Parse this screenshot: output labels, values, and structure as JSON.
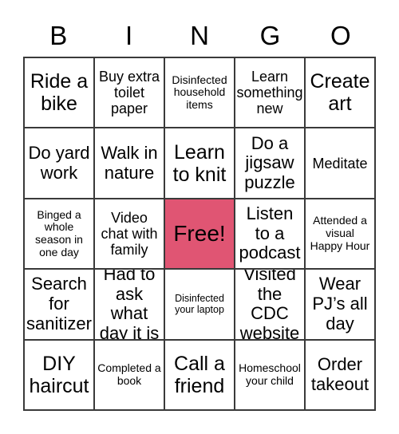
{
  "card": {
    "header_letters": [
      "B",
      "I",
      "N",
      "G",
      "O"
    ],
    "free_space_color": "#E05573",
    "border_color": "#3a3a3a",
    "background_color": "#ffffff",
    "text_color": "#000000",
    "grid_size": "5x5",
    "rows": [
      [
        {
          "text": "Ride a bike",
          "size": "xl",
          "free": false
        },
        {
          "text": "Buy extra toilet paper",
          "size": "md",
          "free": false
        },
        {
          "text": "Disinfected household items",
          "size": "sm",
          "free": false
        },
        {
          "text": "Learn something new",
          "size": "md",
          "free": false
        },
        {
          "text": "Create art",
          "size": "xl",
          "free": false
        }
      ],
      [
        {
          "text": "Do yard work",
          "size": "lg",
          "free": false
        },
        {
          "text": "Walk in nature",
          "size": "lg",
          "free": false
        },
        {
          "text": "Learn to knit",
          "size": "xl",
          "free": false
        },
        {
          "text": "Do a jigsaw puzzle",
          "size": "lg",
          "free": false
        },
        {
          "text": "Meditate",
          "size": "md",
          "free": false
        }
      ],
      [
        {
          "text": "Binged a whole season in one day",
          "size": "sm",
          "free": false
        },
        {
          "text": "Video chat with family",
          "size": "md",
          "free": false
        },
        {
          "text": "Free!",
          "size": "free",
          "free": true
        },
        {
          "text": "Listen to a podcast",
          "size": "lg",
          "free": false
        },
        {
          "text": "Attended a visual Happy Hour",
          "size": "sm",
          "free": false
        }
      ],
      [
        {
          "text": "Search for sanitizer",
          "size": "lg",
          "free": false
        },
        {
          "text": "Had to ask what day it is",
          "size": "lg",
          "free": false
        },
        {
          "text": "Disinfected your laptop",
          "size": "xs",
          "free": false
        },
        {
          "text": "Visited the CDC website",
          "size": "lg",
          "free": false
        },
        {
          "text": "Wear PJ’s all day",
          "size": "lg",
          "free": false
        }
      ],
      [
        {
          "text": "DIY haircut",
          "size": "xl",
          "free": false
        },
        {
          "text": "Completed a book",
          "size": "sm",
          "free": false
        },
        {
          "text": "Call a friend",
          "size": "xl",
          "free": false
        },
        {
          "text": "Homeschool your child",
          "size": "sm",
          "free": false
        },
        {
          "text": "Order takeout",
          "size": "lg",
          "free": false
        }
      ]
    ]
  }
}
